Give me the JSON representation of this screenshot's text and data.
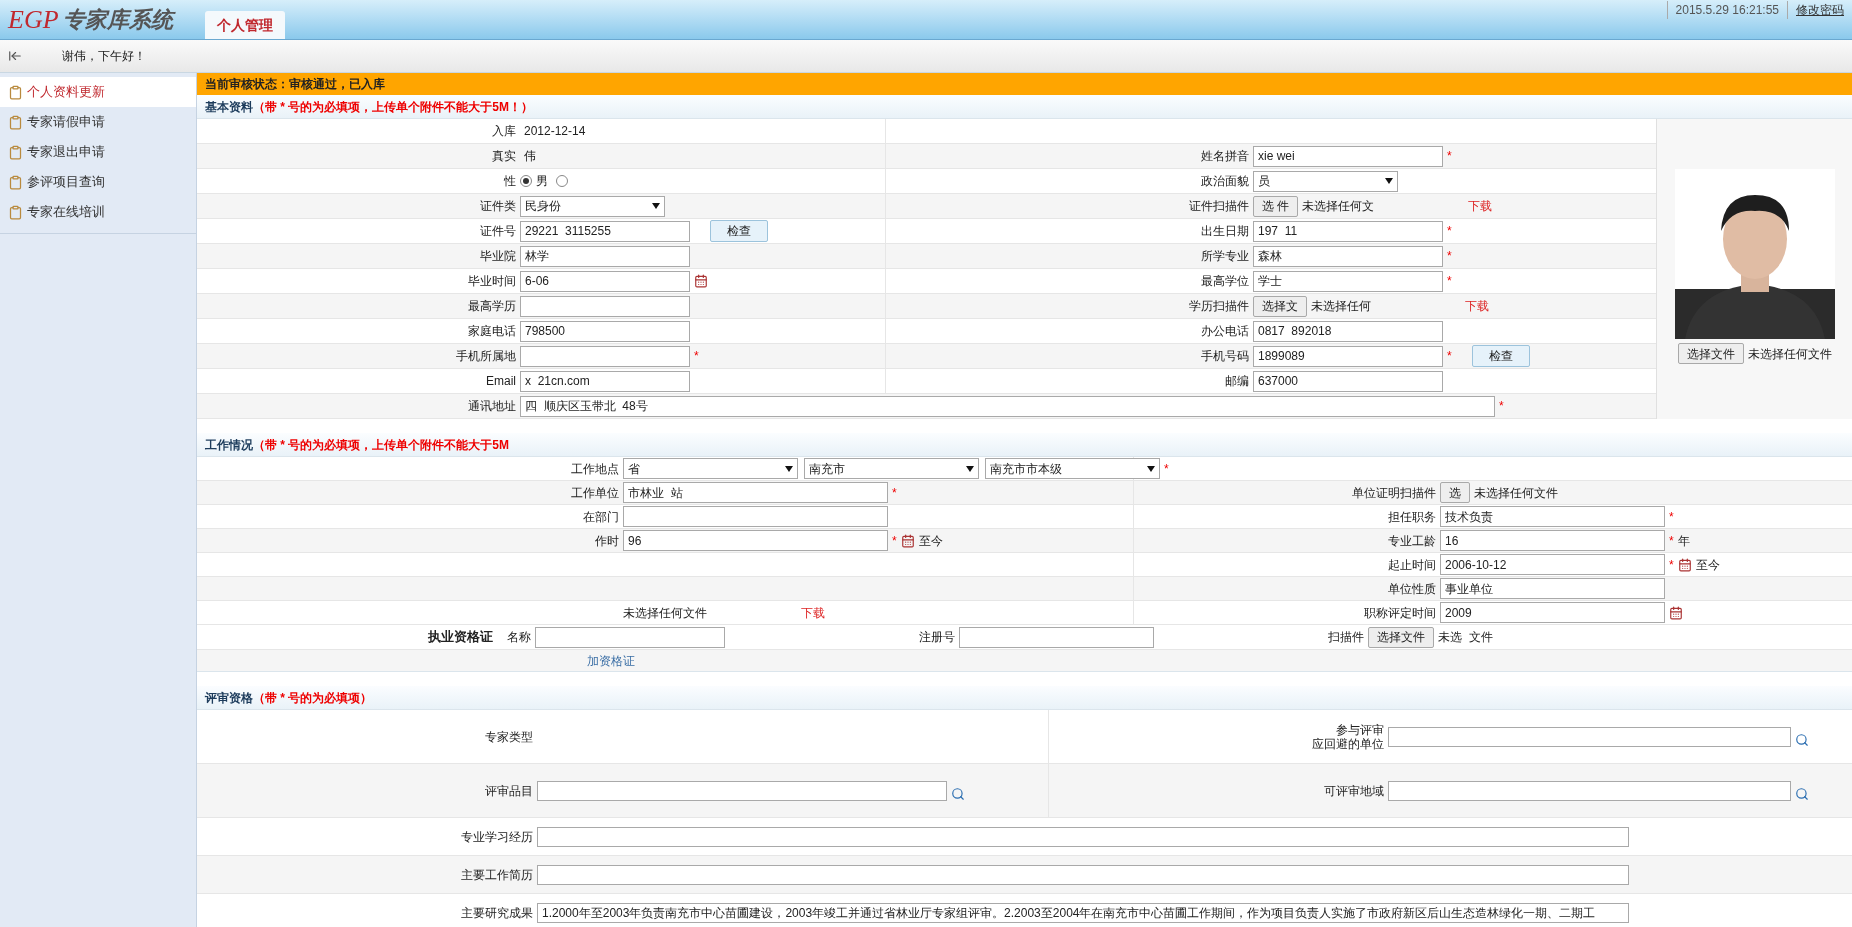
{
  "header": {
    "logo": "EGP",
    "system_title": "专家库系统",
    "tabs": [
      {
        "label": "个人管理",
        "selected": true
      }
    ],
    "datetime": "2015.5.29 16:21:55",
    "link": "修改密码"
  },
  "greeting": "谢伟，下午好！",
  "sidebar": {
    "items": [
      {
        "label": "个人资料更新",
        "selected": true
      },
      {
        "label": "专家请假申请",
        "selected": false
      },
      {
        "label": "专家退出申请",
        "selected": false
      },
      {
        "label": "参评项目查询",
        "selected": false
      },
      {
        "label": "专家在线培训",
        "selected": false
      }
    ]
  },
  "status_bar": "当前审核状态：审核通过，已入库",
  "basic": {
    "title": "基本资料",
    "note": "（带 * 号的为必填项，上传单个附件不能大于5M！）",
    "rows": [
      {
        "left": {
          "label": "入库",
          "kind": "plain",
          "value": "2012-12-14"
        }
      },
      {
        "left": {
          "label": "真实",
          "kind": "plain",
          "value": "伟"
        },
        "right": {
          "label": "姓名拼音",
          "kind": "input",
          "value": "xie wei",
          "required": "*"
        }
      },
      {
        "left": {
          "label": "性",
          "kind": "radio",
          "options": [
            {
              "label": "男",
              "selected": true
            },
            {
              "selected": false
            }
          ]
        },
        "right": {
          "label": "政治面貌",
          "kind": "select",
          "value": "员"
        }
      },
      {
        "left": {
          "label": "证件类",
          "kind": "select",
          "value": "民身份"
        },
        "right": {
          "label": "证件扫描件",
          "kind": "file",
          "button": "选 件",
          "status": "未选择任何文",
          "download": "下载"
        }
      },
      {
        "left": {
          "label": "证件号",
          "kind": "input",
          "value": "29221  3115255",
          "button": "检查"
        },
        "right": {
          "label": "出生日期",
          "kind": "input",
          "value": "197  11",
          "required": "*"
        }
      },
      {
        "left": {
          "label": "毕业院",
          "kind": "input",
          "value": "林学"
        },
        "right": {
          "label": "所学专业",
          "kind": "input",
          "value": "森林",
          "required": "*"
        }
      },
      {
        "left": {
          "label": "毕业时间",
          "kind": "input",
          "value": "6-06",
          "calendar": true
        },
        "right": {
          "label": "最高学位",
          "kind": "input",
          "value": "学士",
          "required": "*"
        }
      },
      {
        "left": {
          "label": "最高学历",
          "kind": "input"
        },
        "right": {
          "label": "学历扫描件",
          "kind": "file",
          "button": "选择文",
          "status": "未选择任何",
          "download": "下载"
        }
      },
      {
        "left": {
          "label": "家庭电话",
          "kind": "input",
          "value": "798500"
        },
        "right": {
          "label": "办公电话",
          "kind": "input",
          "value": "0817  892018"
        }
      },
      {
        "left": {
          "label": "手机所属地",
          "kind": "input",
          "required": "*"
        },
        "right": {
          "label": "手机号码",
          "kind": "input",
          "value": "1899089",
          "required": "*",
          "button": "检查"
        }
      },
      {
        "left": {
          "label": "Email",
          "kind": "input",
          "value": "x  21cn.com"
        },
        "right": {
          "label": "邮编",
          "kind": "input",
          "value": "637000"
        }
      },
      {
        "full": {
          "label": "通讯地址",
          "kind": "wide",
          "value": "四  顺庆区玉带北  48号",
          "required": "*"
        }
      }
    ],
    "photo": {
      "button": "选择文件",
      "status": "未选择任何文件"
    }
  },
  "work": {
    "title": "工作情况",
    "note": "（带 * 号的为必填项，上传单个附件不能大于5M",
    "rows": [
      {
        "left": {
          "label": "工作地点",
          "kind": "selects",
          "values": [
            "省",
            "南充市",
            "南充市市本级"
          ],
          "required": "*"
        }
      },
      {
        "left": {
          "label": "工作单位",
          "kind": "input",
          "value": "市林业  站",
          "required": "*"
        },
        "right": {
          "label": "单位证明扫描件",
          "kind": "file",
          "button": "选",
          "status": "未选择任何文件"
        }
      },
      {
        "left": {
          "label": "在部门",
          "kind": "input"
        },
        "right": {
          "label": "担任职务",
          "kind": "input",
          "value": "技术负责",
          "required": "*"
        }
      },
      {
        "left": {
          "label": "作时",
          "kind": "input",
          "value": "96",
          "required": "*",
          "calendar": true,
          "suffix": "至今"
        },
        "right": {
          "label": "专业工龄",
          "kind": "input",
          "value": "16",
          "required": "*",
          "suffix": "年"
        }
      },
      {
        "right": {
          "label": "起止时间",
          "kind": "input",
          "value": "2006-10-12",
          "required": "*",
          "calendar": true,
          "suffix": "至今"
        }
      },
      {
        "right": {
          "label": "单位性质",
          "kind": "input",
          "value": "事业单位"
        }
      },
      {
        "left": {
          "kind": "file",
          "status": "未选择任何文件",
          "download": "下载"
        },
        "right": {
          "label": "职称评定时间",
          "kind": "input",
          "value": "2009",
          "calendar": true
        }
      }
    ],
    "license": {
      "title": "执业资格证",
      "name_label": "名称",
      "number_label": "注册号",
      "scan_label": "扫描件",
      "scan_button": "选择文件",
      "scan_status": "未选  文件"
    },
    "add_link": "加资格证"
  },
  "review": {
    "title": "评审资格",
    "note": "（带 * 号的为必填项）",
    "rows": [
      {
        "left": {
          "label": "专家类型",
          "kind": "none"
        },
        "right": {
          "label": [
            "参与评审",
            "应回避的单位"
          ],
          "kind": "textarea",
          "search": true
        }
      },
      {
        "left": {
          "label": "评审品目",
          "kind": "textarea",
          "search": true
        },
        "right": {
          "label": "可评审地域",
          "kind": "textarea",
          "search": true
        }
      },
      {
        "full": {
          "label": "专业学习经历",
          "kind": "textarea"
        }
      },
      {
        "full": {
          "label": "主要工作简历",
          "kind": "textarea"
        }
      },
      {
        "full": {
          "label": "主要研究成果",
          "kind": "textarea",
          "value": "1.2000年至2003年负责南充市中心苗圃建设，2003年竣工并通过省林业厅专家组评审。2.2003至2004年在南充市中心苗圃工作期间，作为项目负责人实施了市政府新区后山生态造林绿化一期、二期工"
        }
      }
    ]
  }
}
